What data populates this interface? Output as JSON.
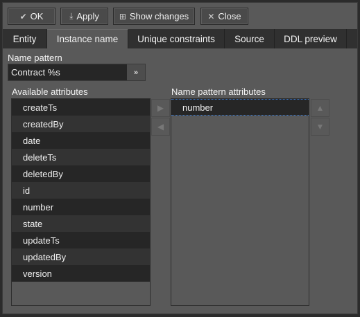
{
  "toolbar": {
    "ok": "OK",
    "apply": "Apply",
    "show_changes": "Show changes",
    "close": "Close"
  },
  "tabs": [
    "Entity",
    "Instance name",
    "Unique constraints",
    "Source",
    "DDL preview"
  ],
  "active_tab": "Instance name",
  "name_pattern": {
    "label": "Name pattern",
    "value": "Contract %s"
  },
  "available": {
    "label": "Available attributes",
    "items": [
      "createTs",
      "createdBy",
      "date",
      "deleteTs",
      "deletedBy",
      "id",
      "number",
      "state",
      "updateTs",
      "updatedBy",
      "version"
    ]
  },
  "selected": {
    "label": "Name pattern attributes",
    "items": [
      "number"
    ]
  }
}
